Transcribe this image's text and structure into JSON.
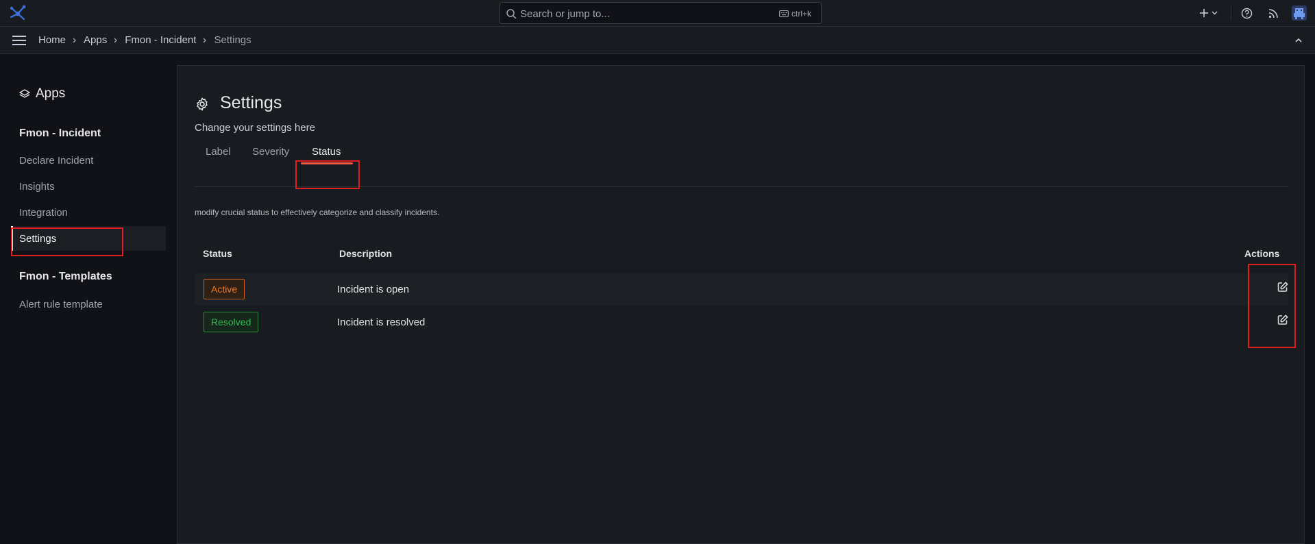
{
  "topbar": {
    "search_placeholder": "Search or jump to...",
    "shortcut": "ctrl+k"
  },
  "breadcrumb": [
    {
      "label": "Home"
    },
    {
      "label": "Apps"
    },
    {
      "label": "Fmon - Incident"
    },
    {
      "label": "Settings"
    }
  ],
  "sidebar": {
    "header": "Apps",
    "groups": [
      {
        "title": "Fmon - Incident",
        "items": [
          "Declare Incident",
          "Insights",
          "Integration",
          "Settings"
        ]
      },
      {
        "title": "Fmon - Templates",
        "items": [
          "Alert rule template"
        ]
      }
    ],
    "active_item": "Settings"
  },
  "page": {
    "title": "Settings",
    "subtitle": "Change your settings here",
    "tabs": [
      "Label",
      "Severity",
      "Status"
    ],
    "active_tab": "Status",
    "description": "modify crucial status to effectively categorize and classify incidents."
  },
  "table": {
    "headers": [
      "Status",
      "Description",
      "Actions"
    ],
    "rows": [
      {
        "status": "Active",
        "description": "Incident is open",
        "color": "#f07b2b"
      },
      {
        "status": "Resolved",
        "description": "Incident is resolved",
        "color": "#35b850"
      }
    ]
  },
  "colors": {
    "highlight": "#e02020",
    "tab_indicator": "#f0584a",
    "brand": "#3d71d9"
  }
}
